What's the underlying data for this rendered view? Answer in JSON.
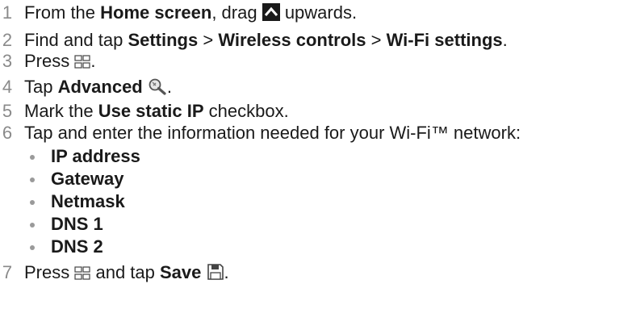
{
  "steps": [
    {
      "num": "1",
      "a": "From the ",
      "b": "Home screen",
      "c": ", drag ",
      "d": " upwards."
    },
    {
      "num": "2",
      "a": "Find and tap ",
      "b": "Settings",
      "c": " > ",
      "d": "Wireless controls",
      "e": " > ",
      "f": "Wi-Fi settings",
      "g": "."
    },
    {
      "num": "3",
      "a": "Press ",
      "b": "."
    },
    {
      "num": "4",
      "a": "Tap ",
      "b": "Advanced",
      "c": "."
    },
    {
      "num": "5",
      "a": "Mark the ",
      "b": "Use static IP",
      "c": " checkbox."
    },
    {
      "num": "6",
      "a": "Tap and enter the information needed for your Wi-Fi™ network:"
    },
    {
      "num": "7",
      "a": "Press ",
      "b": " and tap ",
      "c": "Save",
      "d": "."
    }
  ],
  "fields": [
    "IP address",
    "Gateway",
    "Netmask",
    "DNS 1",
    "DNS 2"
  ],
  "icons": {
    "up_arrow": "up-arrow-icon",
    "menu": "menu-icon",
    "advanced": "magnifier-wrench-icon",
    "save": "save-icon"
  }
}
